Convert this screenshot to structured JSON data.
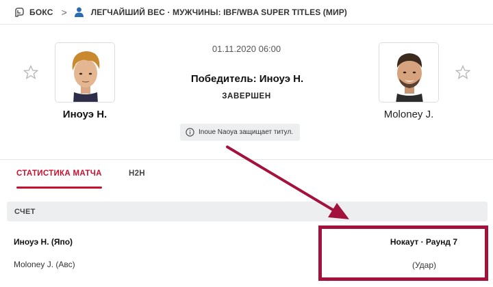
{
  "breadcrumb": {
    "sport_icon": "boxing-glove-icon",
    "sport": "БОКС",
    "separator": ">",
    "league_icon": "person-icon",
    "league": "ЛЕГЧАЙШИЙ ВЕС · МУЖЧИНЫ: IBF/WBA SUPER TITLES (МИР)"
  },
  "match": {
    "date": "01.11.2020 06:00",
    "winner": "Победитель: Иноуэ Н.",
    "status": "ЗАВЕРШЕН",
    "info_icon": "info-circle-icon",
    "info_text": "Inoue Naoya защищает титул."
  },
  "fighters": {
    "home": {
      "name": "Иноуэ Н.",
      "photo_icon": "fighter-photo"
    },
    "away": {
      "name": "Moloney J.",
      "photo_icon": "fighter-photo"
    }
  },
  "tabs": [
    {
      "label": "СТАТИСТИКА МАТЧА",
      "active": true
    },
    {
      "label": "H2H",
      "active": false
    }
  ],
  "score": {
    "header": "СЧЕТ",
    "rows": [
      {
        "name": "Иноуэ Н. (Япо)"
      },
      {
        "name": "Moloney J. (Авс)"
      }
    ],
    "result": "Нокаут · Раунд 7",
    "method": "(Удар)"
  },
  "colors": {
    "accent_red": "#c8102e",
    "annotation": "#a3123d",
    "badge_bg": "#eceef0"
  }
}
